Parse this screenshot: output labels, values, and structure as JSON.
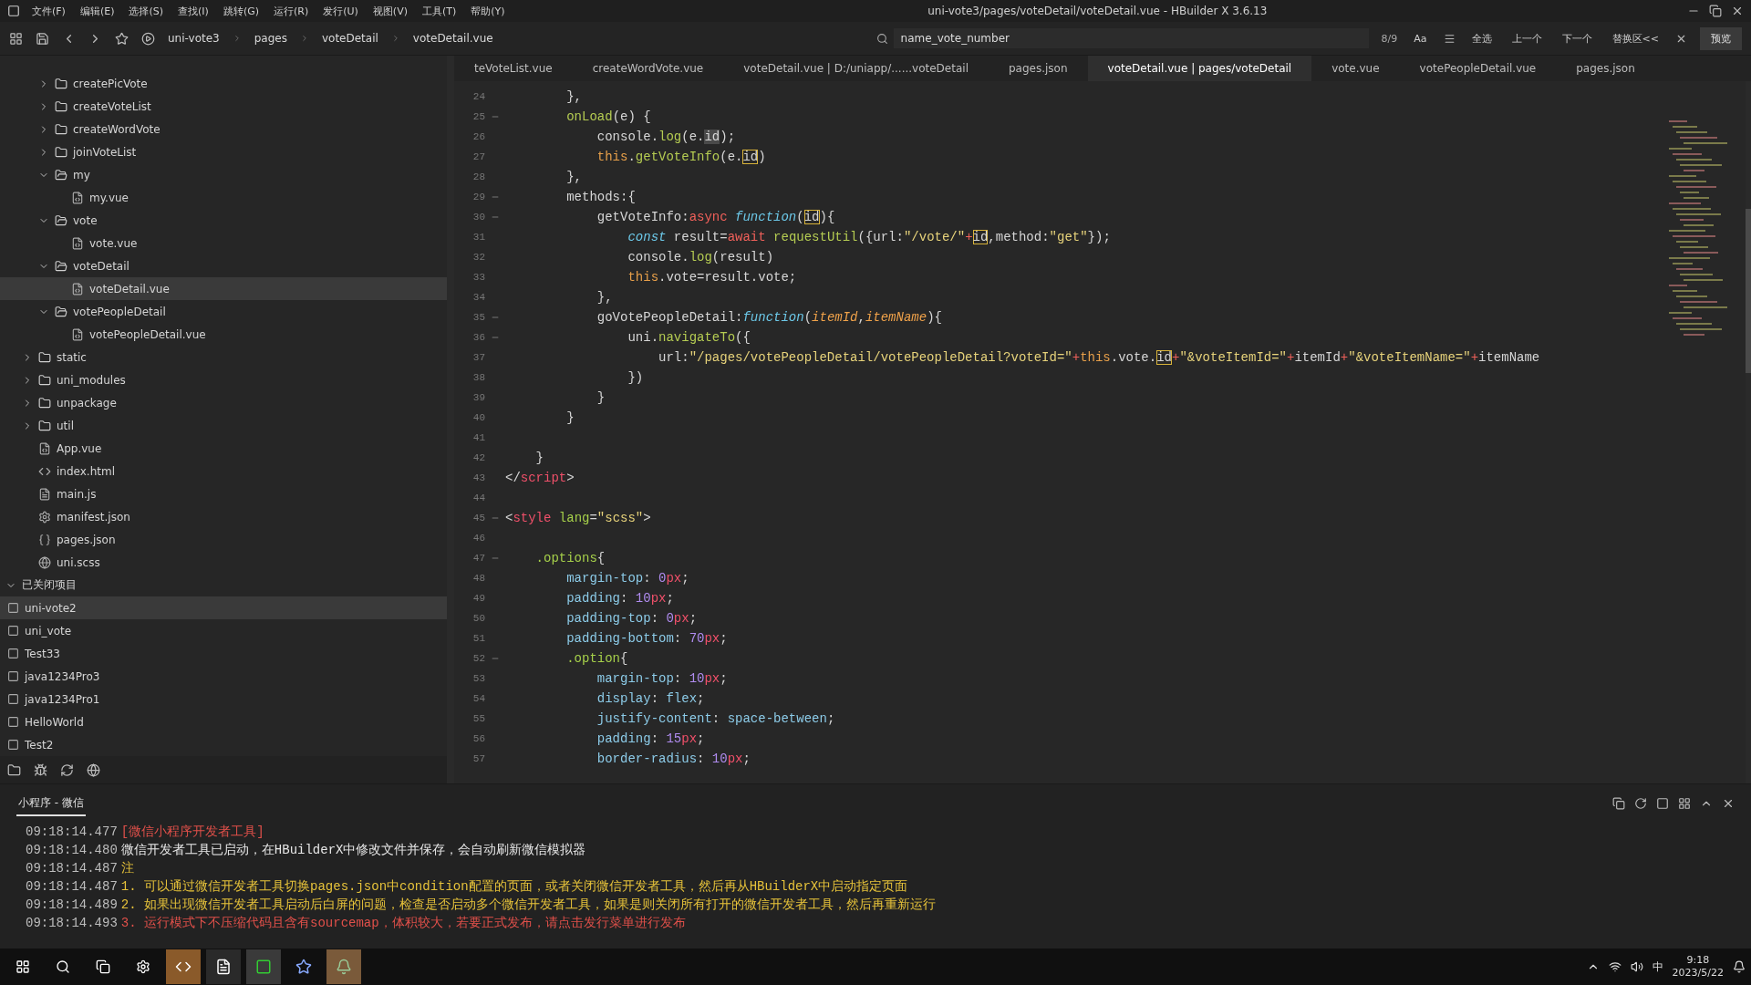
{
  "window": {
    "title": "uni-vote3/pages/voteDetail/voteDetail.vue - HBuilder X 3.6.13"
  },
  "menu": [
    "文件(F)",
    "编辑(E)",
    "选择(S)",
    "查找(I)",
    "跳转(G)",
    "运行(R)",
    "发行(U)",
    "视图(V)",
    "工具(T)",
    "帮助(Y)"
  ],
  "toolbar": {
    "breadcrumb": [
      "uni-vote3",
      "pages",
      "voteDetail",
      "voteDetail.vue"
    ],
    "search": {
      "value": "name_vote_number"
    },
    "match_count": "8/9",
    "case_toggle": "Aa",
    "actions": [
      "全选",
      "上一个",
      "下一个",
      "替换区<<"
    ],
    "preview_button": "预览"
  },
  "tabs": [
    {
      "label": "teVoteList.vue",
      "selected": false
    },
    {
      "label": "createWordVote.vue",
      "selected": false
    },
    {
      "label": "voteDetail.vue | D:/uniapp/......voteDetail",
      "selected": false
    },
    {
      "label": "pages.json",
      "selected": false
    },
    {
      "label": "voteDetail.vue | pages/voteDetail",
      "selected": true
    },
    {
      "label": "vote.vue",
      "selected": false
    },
    {
      "label": "votePeopleDetail.vue",
      "selected": false
    },
    {
      "label": "pages.json",
      "selected": false
    }
  ],
  "sidebar": {
    "nested_items": [
      {
        "label": "createPicVote",
        "kind": "folder",
        "expanded": false,
        "selected": false
      },
      {
        "label": "createVoteList",
        "kind": "folder",
        "expanded": false,
        "selected": false
      },
      {
        "label": "createWordVote",
        "kind": "folder",
        "expanded": false,
        "selected": false
      },
      {
        "label": "joinVoteList",
        "kind": "folder",
        "expanded": false,
        "selected": false
      },
      {
        "label": "my",
        "kind": "folder",
        "expanded": true,
        "selected": false,
        "children": [
          {
            "label": "my.vue",
            "kind": "vue",
            "selected": false
          }
        ]
      },
      {
        "label": "vote",
        "kind": "folder",
        "expanded": true,
        "selected": false,
        "children": [
          {
            "label": "vote.vue",
            "kind": "vue",
            "selected": false
          }
        ]
      },
      {
        "label": "voteDetail",
        "kind": "folder",
        "expanded": true,
        "selected": false,
        "children": [
          {
            "label": "voteDetail.vue",
            "kind": "vue",
            "selected": true
          }
        ]
      },
      {
        "label": "votePeopleDetail",
        "kind": "folder",
        "expanded": true,
        "selected": false,
        "children": [
          {
            "label": "votePeopleDetail.vue",
            "kind": "vue",
            "selected": false
          }
        ]
      }
    ],
    "items": [
      {
        "label": "static",
        "kind": "folder",
        "expanded": false,
        "selected": false
      },
      {
        "label": "uni_modules",
        "kind": "folder",
        "expanded": false,
        "selected": false
      },
      {
        "label": "unpackage",
        "kind": "folder",
        "expanded": false,
        "selected": false
      },
      {
        "label": "util",
        "kind": "folder",
        "expanded": false,
        "selected": false
      },
      {
        "label": "App.vue",
        "kind": "vue",
        "selected": false
      },
      {
        "label": "index.html",
        "kind": "html",
        "selected": false
      },
      {
        "label": "main.js",
        "kind": "js",
        "selected": false
      },
      {
        "label": "manifest.json",
        "kind": "manifest",
        "selected": false
      },
      {
        "label": "pages.json",
        "kind": "json",
        "selected": false
      },
      {
        "label": "uni.scss",
        "kind": "scss",
        "selected": false
      }
    ],
    "closed_projects": {
      "label": "已关闭项目",
      "expanded": true,
      "items": [
        {
          "label": "uni-vote2",
          "selected": true
        },
        {
          "label": "uni_vote",
          "selected": false
        },
        {
          "label": "Test33",
          "selected": false
        },
        {
          "label": "java1234Pro3",
          "selected": false
        },
        {
          "label": "java1234Pro1",
          "selected": false
        },
        {
          "label": "HelloWorld",
          "selected": false
        },
        {
          "label": "Test2",
          "selected": false
        }
      ]
    }
  },
  "editor": {
    "lines": [
      {
        "n": "24",
        "fold": false,
        "tokens": [
          {
            "text": "        },",
            "kind": "plain"
          }
        ]
      },
      {
        "n": "25",
        "fold": true,
        "tokens": [
          {
            "text": "        onLoad",
            "kind": "function"
          },
          {
            "text": "(e) {",
            "kind": "plain"
          }
        ]
      },
      {
        "n": "26",
        "fold": false,
        "tokens": [
          {
            "text": "            console.",
            "kind": "plain"
          },
          {
            "text": "log",
            "kind": "function"
          },
          {
            "text": "(e.",
            "kind": "plain"
          },
          {
            "text": "id",
            "kind": "selection"
          },
          {
            "text": ");",
            "kind": "plain"
          }
        ]
      },
      {
        "n": "27",
        "fold": false,
        "tokens": [
          {
            "text": "            this",
            "kind": "keyword"
          },
          {
            "text": ".",
            "kind": "plain"
          },
          {
            "text": "getVoteInfo",
            "kind": "function"
          },
          {
            "text": "(e.",
            "kind": "plain"
          },
          {
            "text": "id",
            "kind": "match"
          },
          {
            "text": ")",
            "kind": "plain"
          }
        ]
      },
      {
        "n": "28",
        "fold": false,
        "tokens": [
          {
            "text": "        },",
            "kind": "plain"
          }
        ]
      },
      {
        "n": "29",
        "fold": true,
        "tokens": [
          {
            "text": "        methods:{",
            "kind": "plain"
          }
        ]
      },
      {
        "n": "30",
        "fold": true,
        "tokens": [
          {
            "text": "            getVoteInfo:",
            "kind": "plain"
          },
          {
            "text": "async ",
            "kind": "operator"
          },
          {
            "text": "function",
            "kind": "storage"
          },
          {
            "text": "(",
            "kind": "plain"
          },
          {
            "text": "id",
            "kind": "match"
          },
          {
            "text": "){",
            "kind": "plain"
          }
        ]
      },
      {
        "n": "31",
        "fold": false,
        "tokens": [
          {
            "text": "                const",
            "kind": "storage"
          },
          {
            "text": " result=",
            "kind": "plain"
          },
          {
            "text": "await ",
            "kind": "operator"
          },
          {
            "text": "requestUtil",
            "kind": "function"
          },
          {
            "text": "({url:",
            "kind": "plain"
          },
          {
            "text": "\"/vote/\"",
            "kind": "string"
          },
          {
            "text": "+",
            "kind": "operator"
          },
          {
            "text": "id",
            "kind": "match"
          },
          {
            "text": ",method:",
            "kind": "plain"
          },
          {
            "text": "\"get\"",
            "kind": "string"
          },
          {
            "text": "});",
            "kind": "plain"
          }
        ]
      },
      {
        "n": "32",
        "fold": false,
        "tokens": [
          {
            "text": "                console.",
            "kind": "plain"
          },
          {
            "text": "log",
            "kind": "function"
          },
          {
            "text": "(result)",
            "kind": "plain"
          }
        ]
      },
      {
        "n": "33",
        "fold": false,
        "tokens": [
          {
            "text": "                this",
            "kind": "keyword"
          },
          {
            "text": ".vote=result.vote;",
            "kind": "plain"
          }
        ]
      },
      {
        "n": "34",
        "fold": false,
        "tokens": [
          {
            "text": "            },",
            "kind": "plain"
          }
        ]
      },
      {
        "n": "35",
        "fold": true,
        "tokens": [
          {
            "text": "            goVotePeopleDetail:",
            "kind": "plain"
          },
          {
            "text": "function",
            "kind": "storage"
          },
          {
            "text": "(",
            "kind": "plain"
          },
          {
            "text": "itemId",
            "kind": "parameter"
          },
          {
            "text": ",",
            "kind": "plain"
          },
          {
            "text": "itemName",
            "kind": "parameter"
          },
          {
            "text": "){",
            "kind": "plain"
          }
        ]
      },
      {
        "n": "36",
        "fold": true,
        "tokens": [
          {
            "text": "                uni.",
            "kind": "plain"
          },
          {
            "text": "navigateTo",
            "kind": "function"
          },
          {
            "text": "({",
            "kind": "plain"
          }
        ]
      },
      {
        "n": "37",
        "fold": false,
        "tokens": [
          {
            "text": "                    url:",
            "kind": "plain"
          },
          {
            "text": "\"/pages/votePeopleDetail/votePeopleDetail?voteId=\"",
            "kind": "string"
          },
          {
            "text": "+",
            "kind": "operator"
          },
          {
            "text": "this",
            "kind": "keyword"
          },
          {
            "text": ".vote.",
            "kind": "plain"
          },
          {
            "text": "id",
            "kind": "match"
          },
          {
            "text": "+",
            "kind": "operator"
          },
          {
            "text": "\"&voteItemId=\"",
            "kind": "string"
          },
          {
            "text": "+",
            "kind": "operator"
          },
          {
            "text": "itemId",
            "kind": "plain"
          },
          {
            "text": "+",
            "kind": "operator"
          },
          {
            "text": "\"&voteItemName=\"",
            "kind": "string"
          },
          {
            "text": "+",
            "kind": "operator"
          },
          {
            "text": "itemName",
            "kind": "plain"
          }
        ]
      },
      {
        "n": "38",
        "fold": false,
        "tokens": [
          {
            "text": "                })",
            "kind": "plain"
          }
        ]
      },
      {
        "n": "39",
        "fold": false,
        "tokens": [
          {
            "text": "            }",
            "kind": "plain"
          }
        ]
      },
      {
        "n": "40",
        "fold": false,
        "tokens": [
          {
            "text": "        }",
            "kind": "plain"
          }
        ]
      },
      {
        "n": "41",
        "fold": false
      },
      {
        "n": "42",
        "fold": false,
        "tokens": [
          {
            "text": "    }",
            "kind": "plain"
          }
        ]
      },
      {
        "n": "43",
        "fold": false,
        "tokens": [
          {
            "text": "</",
            "kind": "plain"
          },
          {
            "text": "script",
            "kind": "tag"
          },
          {
            "text": ">",
            "kind": "plain"
          }
        ]
      },
      {
        "n": "44",
        "fold": false
      },
      {
        "n": "45",
        "fold": true,
        "tokens": [
          {
            "text": "<",
            "kind": "plain"
          },
          {
            "text": "style",
            "kind": "tag"
          },
          {
            "text": " lang",
            "kind": "attribute"
          },
          {
            "text": "=",
            "kind": "plain"
          },
          {
            "text": "\"scss\"",
            "kind": "string"
          },
          {
            "text": ">",
            "kind": "plain"
          }
        ]
      },
      {
        "n": "46",
        "fold": false
      },
      {
        "n": "47",
        "fold": true,
        "tokens": [
          {
            "text": "    .options",
            "kind": "attribute"
          },
          {
            "text": "{",
            "kind": "plain"
          }
        ]
      },
      {
        "n": "48",
        "fold": false,
        "tokens": [
          {
            "text": "        margin-top",
            "kind": "property"
          },
          {
            "text": ": ",
            "kind": "plain"
          },
          {
            "text": "0",
            "kind": "number"
          },
          {
            "text": "px",
            "kind": "unit"
          },
          {
            "text": ";",
            "kind": "plain"
          }
        ]
      },
      {
        "n": "49",
        "fold": false,
        "tokens": [
          {
            "text": "        padding",
            "kind": "property"
          },
          {
            "text": ": ",
            "kind": "plain"
          },
          {
            "text": "10",
            "kind": "number"
          },
          {
            "text": "px",
            "kind": "unit"
          },
          {
            "text": ";",
            "kind": "plain"
          }
        ]
      },
      {
        "n": "50",
        "fold": false,
        "tokens": [
          {
            "text": "        padding-top",
            "kind": "property"
          },
          {
            "text": ": ",
            "kind": "plain"
          },
          {
            "text": "0",
            "kind": "number"
          },
          {
            "text": "px",
            "kind": "unit"
          },
          {
            "text": ";",
            "kind": "plain"
          }
        ]
      },
      {
        "n": "51",
        "fold": false,
        "tokens": [
          {
            "text": "        padding-bottom",
            "kind": "property"
          },
          {
            "text": ": ",
            "kind": "plain"
          },
          {
            "text": "70",
            "kind": "number"
          },
          {
            "text": "px",
            "kind": "unit"
          },
          {
            "text": ";",
            "kind": "plain"
          }
        ]
      },
      {
        "n": "52",
        "fold": true,
        "tokens": [
          {
            "text": "        .option",
            "kind": "attribute"
          },
          {
            "text": "{",
            "kind": "plain"
          }
        ]
      },
      {
        "n": "53",
        "fold": false,
        "tokens": [
          {
            "text": "            margin-top",
            "kind": "property"
          },
          {
            "text": ": ",
            "kind": "plain"
          },
          {
            "text": "10",
            "kind": "number"
          },
          {
            "text": "px",
            "kind": "unit"
          },
          {
            "text": ";",
            "kind": "plain"
          }
        ]
      },
      {
        "n": "54",
        "fold": false,
        "tokens": [
          {
            "text": "            display",
            "kind": "property"
          },
          {
            "text": ": ",
            "kind": "plain"
          },
          {
            "text": "flex",
            "kind": "property"
          },
          {
            "text": ";",
            "kind": "plain"
          }
        ]
      },
      {
        "n": "55",
        "fold": false,
        "tokens": [
          {
            "text": "            justify-content",
            "kind": "property"
          },
          {
            "text": ": ",
            "kind": "plain"
          },
          {
            "text": "space-between",
            "kind": "property"
          },
          {
            "text": ";",
            "kind": "plain"
          }
        ]
      },
      {
        "n": "56",
        "fold": false,
        "tokens": [
          {
            "text": "            padding",
            "kind": "property"
          },
          {
            "text": ": ",
            "kind": "plain"
          },
          {
            "text": "15",
            "kind": "number"
          },
          {
            "text": "px",
            "kind": "unit"
          },
          {
            "text": ";",
            "kind": "plain"
          }
        ]
      },
      {
        "n": "57",
        "fold": false,
        "tokens": [
          {
            "text": "            border-radius",
            "kind": "property"
          },
          {
            "text": ": ",
            "kind": "plain"
          },
          {
            "text": "10",
            "kind": "number"
          },
          {
            "text": "px",
            "kind": "unit"
          },
          {
            "text": ";",
            "kind": "plain"
          }
        ]
      }
    ]
  },
  "console": {
    "tab": "小程序 - 微信",
    "lines": [
      {
        "time": "09:18:14.477",
        "text": "[微信小程序开发者工具]",
        "kind": "error"
      },
      {
        "time": "09:18:14.480",
        "text": "微信开发者工具已启动，在HBuilderX中修改文件并保存，会自动刷新微信模拟器",
        "kind": "info"
      },
      {
        "time": "09:18:14.487",
        "text": "注",
        "kind": "warn"
      },
      {
        "time": "09:18:14.487",
        "text": "1. 可以通过微信开发者工具切换pages.json中condition配置的页面，或者关闭微信开发者工具，然后再从HBuilderX中启动指定页面",
        "kind": "warn"
      },
      {
        "time": "09:18:14.489",
        "text": "2. 如果出现微信开发者工具启动后白屏的问题，检查是否启动多个微信开发者工具，如果是则关闭所有打开的微信开发者工具，然后再重新运行",
        "kind": "warn"
      },
      {
        "time": "09:18:14.493",
        "text": "3. 运行模式下不压缩代码且含有sourcemap，体积较大，若要正式发布，请点击发行菜单进行发布",
        "kind": "error"
      }
    ]
  },
  "taskbar": {
    "ime": "中",
    "time": "9:18",
    "date": "2023/5/22"
  }
}
